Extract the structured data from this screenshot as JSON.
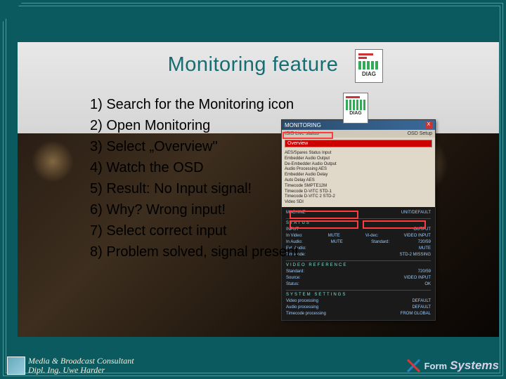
{
  "title": "Monitoring feature",
  "steps": [
    "1) Search for the Monitoring icon",
    "2) Open Monitoring",
    "3) Select „Overview\"",
    "4) Watch the OSD",
    "5) Result: No Input signal!",
    "6) Why? Wrong input!",
    "7) Select correct input",
    "8) Problem solved, signal present"
  ],
  "diag_label": "DIAG",
  "monitor": {
    "window_title": "MONITORING",
    "close": "X",
    "tab_left": "ISIS Live status",
    "tab_right": "OSD Setup",
    "overview_option": "Overview",
    "list": [
      "AES/Spares Status Input",
      "Embedder Audio Output",
      "De-Embedder Audio Output",
      "Audio Processing AES",
      "Embedder Audio Delay",
      "Auto Delay AES",
      "Timecode SMPTE12M",
      "Timecode D-VITC STD-1",
      "Timecode D-VITC 2 STD-2",
      "Video SDI"
    ],
    "osd": {
      "machine": "MACHINE",
      "machine_val": "UNIT/DEFAULT",
      "status": "STATUS",
      "input_hdr": "INPUT",
      "output_hdr": "OUTPUT",
      "rows": [
        [
          "In Video:",
          "MUTE",
          "Vi-dec:",
          "VIDEO INPUT"
        ],
        [
          "In Audio:",
          "MUTE",
          "Standard:",
          "720/59"
        ],
        [
          "Ext. Audio:",
          "MUTE",
          "",
          ""
        ],
        [
          "Timecode:",
          "STD-2 MISSING",
          "",
          ""
        ]
      ],
      "ref_hdr": "VIDEO REFERENCE",
      "ref_rows": [
        [
          "Standard:",
          "720/59"
        ],
        [
          "Source:",
          "VIDEO INPUT"
        ],
        [
          "Status:",
          "OK"
        ]
      ],
      "sys_hdr": "SYSTEM SETTINGS",
      "sys_rows": [
        [
          "Video processing",
          "DEFAULT"
        ],
        [
          "Audio processing",
          "DEFAULT"
        ],
        [
          "Timecode processing",
          "FROM GLOBAL"
        ]
      ]
    }
  },
  "footer": {
    "line1": "Media & Broadcast Consultant",
    "line2": "Dipl. Ing. Uwe Harder",
    "brand1": "Form",
    "brand2": "Systems"
  }
}
